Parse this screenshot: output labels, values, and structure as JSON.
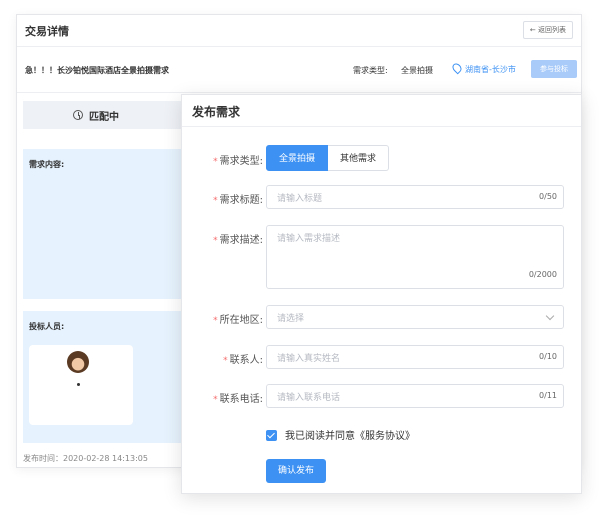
{
  "back": {
    "title": "交易详情",
    "return_label": "← 返回列表",
    "job_title": "急！！！长沙铂悦国际酒店全景拍摄需求",
    "type_label": "需求类型:",
    "type_value": "全景拍摄",
    "location": "湖南省-长沙市",
    "join_label": "参与投标",
    "status": "匹配中",
    "content_label": "需求内容:",
    "bidders_label": "投标人员:",
    "bidder_name": "",
    "publish_time": "发布时间：2020-02-28 14:13:05"
  },
  "dialog": {
    "title": "发布需求",
    "type_label": "需求类型:",
    "type_options": [
      "全景拍摄",
      "其他需求"
    ],
    "title_label": "需求标题:",
    "title_placeholder": "请输入标题",
    "title_count": "0/50",
    "desc_label": "需求描述:",
    "desc_placeholder": "请输入需求描述",
    "desc_count": "0/2000",
    "region_label": "所在地区:",
    "region_placeholder": "请选择",
    "contact_label": "联系人:",
    "contact_placeholder": "请输入真实姓名",
    "contact_count": "0/10",
    "phone_label": "联系电话:",
    "phone_placeholder": "请输入联系电话",
    "phone_count": "0/11",
    "agree_text": "我已阅读并同意《服务协议》",
    "submit_label": "确认发布"
  },
  "colors": {
    "accent": "#3c91f3",
    "panel": "#e6f2fd",
    "required": "#f56c6c"
  }
}
